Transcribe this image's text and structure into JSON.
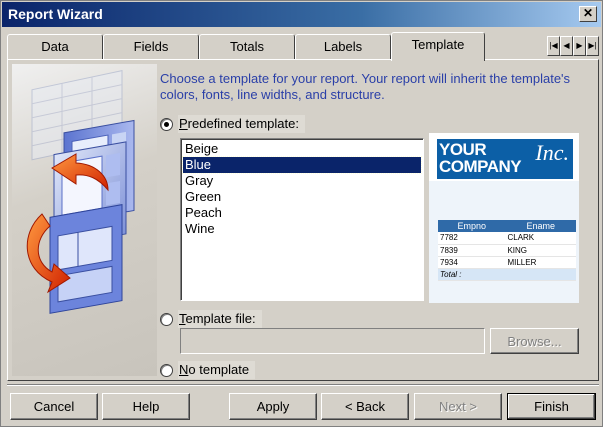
{
  "window": {
    "title": "Report Wizard"
  },
  "tabs": [
    "Data",
    "Fields",
    "Totals",
    "Labels",
    "Template"
  ],
  "active_tab": "Template",
  "instructions": "Choose a template for your report. Your report will inherit the template's colors, fonts, line widths, and structure.",
  "options": {
    "predefined": {
      "label_underlined": "P",
      "label_rest": "redefined template:",
      "checked": true
    },
    "file": {
      "label_underlined": "T",
      "label_rest": "emplate file:",
      "checked": false,
      "value": ""
    },
    "none": {
      "label_underlined": "N",
      "label_rest": "o template",
      "checked": false
    }
  },
  "templates": [
    "Beige",
    "Blue",
    "Gray",
    "Green",
    "Peach",
    "Wine"
  ],
  "selected_template": "Blue",
  "preview": {
    "logo_line1": "YOUR",
    "logo_line2": "COMPANY",
    "logo_inc": "Inc.",
    "columns": [
      "Empno",
      "Ename"
    ],
    "rows": [
      [
        "7782",
        "CLARK"
      ],
      [
        "7839",
        "KING"
      ],
      [
        "7934",
        "MILLER"
      ]
    ],
    "total_label": "Total :"
  },
  "buttons": {
    "browse": "Browse...",
    "cancel": "Cancel",
    "help": "Help",
    "apply": "Apply",
    "back": "< Back",
    "next": "Next >",
    "finish": "Finish"
  },
  "colors": {
    "accent": "#0a246a",
    "instruction_text": "#2a3fa8",
    "preview_brand": "#0c5fa6"
  }
}
